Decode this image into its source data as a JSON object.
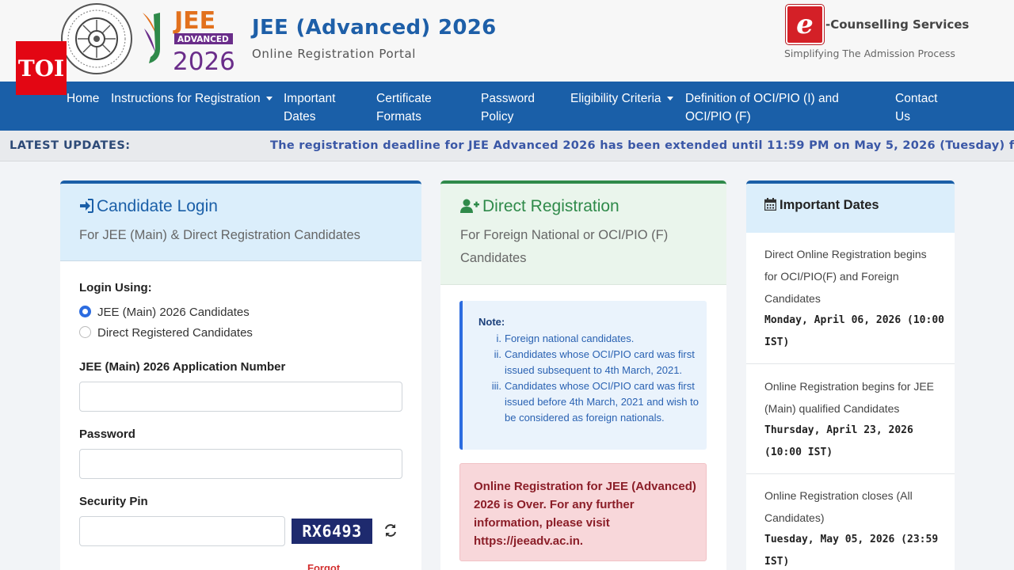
{
  "header": {
    "title": "JEE (Advanced) 2026",
    "subtitle": "Online Registration Portal",
    "jee_logo": {
      "line1": "JEE",
      "line2": "ADVANCED",
      "line3": "2026"
    },
    "counselling": {
      "title": "-Counselling Services",
      "subtitle": "Simplifying The Admission Process",
      "mark": "e"
    },
    "watermark": "TOI"
  },
  "nav": {
    "items": [
      {
        "label": "Home"
      },
      {
        "label": "Instructions for Registration"
      },
      {
        "label": "Important Dates"
      },
      {
        "label": "Certificate Formats"
      },
      {
        "label": "Password Policy"
      },
      {
        "label": "Eligibility Criteria"
      },
      {
        "label": "Definition of OCI/PIO (I) and OCI/PIO (F)"
      },
      {
        "label": "Contact Us"
      }
    ]
  },
  "ticker": {
    "label": "LATEST UPDATES:",
    "text": "The registration deadline for JEE Advanced 2026 has been extended until 11:59 PM on May 5, 2026 (Tuesday) for all th"
  },
  "login": {
    "title": "Candidate Login",
    "subtitle": "For JEE (Main) & Direct Registration Candidates",
    "login_using": "Login Using:",
    "option_main": "JEE (Main) 2026 Candidates",
    "option_direct": "Direct Registered Candidates",
    "app_number_label": "JEE (Main) 2026 Application Number",
    "password_label": "Password",
    "pin_label": "Security Pin",
    "captcha": "RX6493",
    "forgot": "Forgot"
  },
  "direct": {
    "title": "Direct Registration",
    "subtitle": "For Foreign National or OCI/PIO (F) Candidates",
    "note_title": "Note:",
    "notes": [
      {
        "num": "i.",
        "text": "Foreign national candidates."
      },
      {
        "num": "ii.",
        "text": "Candidates whose OCI/PIO card was first issued subsequent to 4th March, 2021."
      },
      {
        "num": "iii.",
        "text": "Candidates whose OCI/PIO card was first issued before 4th March, 2021 and wish to be considered as foreign nationals."
      }
    ],
    "alert": "Online Registration for JEE (Advanced) 2026 is Over. For any further information, please visit https://jeeadv.ac.in."
  },
  "dates": {
    "title": "Important Dates",
    "items": [
      {
        "desc": "Direct Online Registration begins for OCI/PIO(F) and Foreign Candidates",
        "when": "Monday, April 06, 2026 (10:00 IST)"
      },
      {
        "desc": "Online Registration begins for JEE (Main) qualified Candidates",
        "when": "Thursday, April 23, 2026 (10:00 IST)"
      },
      {
        "desc": "Online Registration closes (All Candidates)",
        "when": "Tuesday, May 05, 2026 (23:59 IST)"
      }
    ]
  },
  "colors": {
    "nav_bg": "#1a5fa8",
    "accent_blue": "#2c6ce0",
    "accent_green": "#2f8a4a",
    "alert_bg": "#f8d7da",
    "watermark_red": "#e30613"
  },
  "icons": {
    "login": "sign-in-icon",
    "register": "user-plus-icon",
    "calendar": "calendar-icon",
    "refresh": "refresh-icon"
  }
}
